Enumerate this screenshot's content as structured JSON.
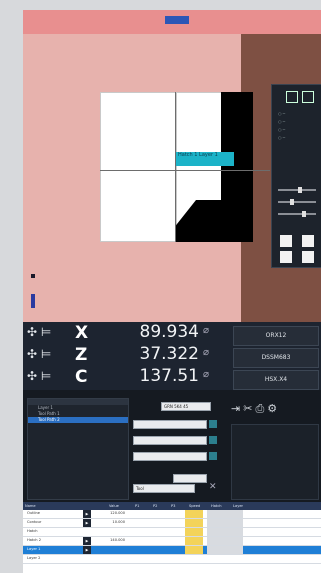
{
  "viewport": {
    "overlay_label": "Hatch 1\nLayer 1"
  },
  "dro": {
    "axes": [
      {
        "letter": "X",
        "value": "89.934"
      },
      {
        "letter": "Z",
        "value": "37.322"
      },
      {
        "letter": "C",
        "value": "137.51"
      }
    ],
    "buttons": [
      "ORX12",
      "DSSM683",
      "HSX.X4"
    ]
  },
  "tree": {
    "items": [
      "Layer 1",
      "Tool Path 1",
      "Tool Path 2"
    ],
    "selected_index": 2
  },
  "form": {
    "fields": [
      "GRN 5K4 45",
      "",
      "",
      "",
      "Tool"
    ]
  },
  "toolbar_icons": [
    "arrow-icon",
    "scissors-icon",
    "printer-icon",
    "gear-icon"
  ],
  "table": {
    "headers": [
      "Name",
      "",
      "Value",
      "P1",
      "P2",
      "P3",
      "Speed",
      "Hatch",
      "Layer"
    ],
    "rows": [
      {
        "name": "Outline",
        "value": "120.000",
        "op": true
      },
      {
        "name": "Contour",
        "value": "10.000",
        "op": true
      },
      {
        "name": "Hatch",
        "value": "",
        "op": false
      },
      {
        "name": "Hatch 2",
        "value": "140.000",
        "op": true
      },
      {
        "name": "Layer 1",
        "value": "",
        "op": true,
        "selected": true
      },
      {
        "name": "Layer 2",
        "value": "",
        "op": false
      }
    ]
  }
}
